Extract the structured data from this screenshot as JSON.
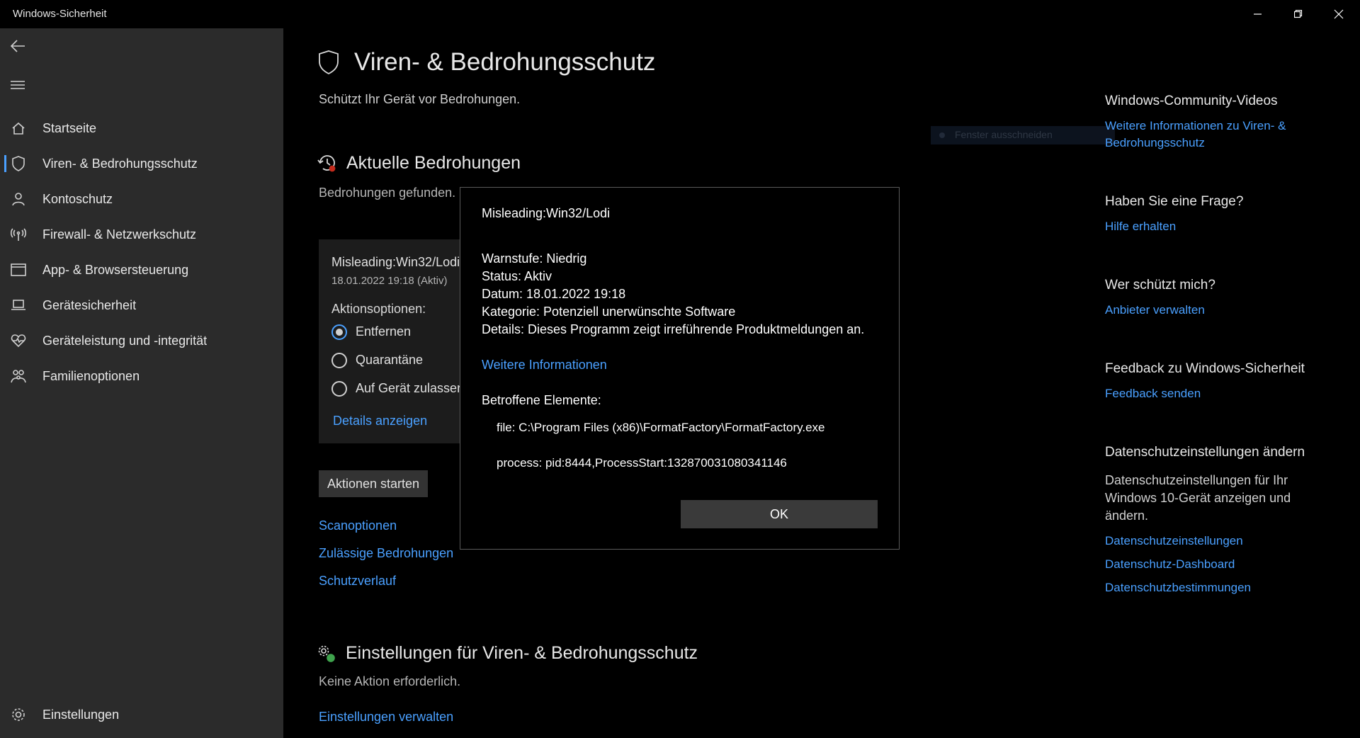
{
  "window": {
    "title": "Windows-Sicherheit"
  },
  "sidebar": {
    "items": [
      {
        "label": "Startseite",
        "icon": "home-icon"
      },
      {
        "label": "Viren- & Bedrohungsschutz",
        "icon": "shield-icon",
        "active": true
      },
      {
        "label": "Kontoschutz",
        "icon": "person-icon"
      },
      {
        "label": "Firewall- & Netzwerkschutz",
        "icon": "antenna-icon"
      },
      {
        "label": "App- & Browsersteuerung",
        "icon": "browser-window-icon"
      },
      {
        "label": "Gerätesicherheit",
        "icon": "laptop-icon"
      },
      {
        "label": "Geräteleistung und -integrität",
        "icon": "heart-pulse-icon"
      },
      {
        "label": "Familienoptionen",
        "icon": "family-icon"
      }
    ],
    "settings_label": "Einstellungen"
  },
  "main": {
    "title": "Viren- & Bedrohungsschutz",
    "subtitle": "Schützt Ihr Gerät vor Bedrohungen.",
    "current_threats": {
      "title": "Aktuelle Bedrohungen",
      "subtitle": "Bedrohungen gefunden.",
      "card": {
        "name": "Misleading:Win32/Lodi",
        "date_status": "18.01.2022 19:18 (Aktiv)",
        "actions_label": "Aktionsoptionen:",
        "options": [
          "Entfernen",
          "Quarantäne",
          "Auf Gerät zulassen"
        ],
        "selected_option": 0,
        "details_link": "Details anzeigen"
      },
      "start_actions_label": "Aktionen starten",
      "links": [
        "Scanoptionen",
        "Zulässige Bedrohungen",
        "Schutzverlauf"
      ]
    },
    "settings_section": {
      "title": "Einstellungen für Viren- & Bedrohungsschutz",
      "subtitle": "Keine Aktion erforderlich.",
      "link": "Einstellungen verwalten"
    }
  },
  "right_panel": {
    "community_title": "Windows-Community-Videos",
    "community_link": "Weitere Informationen zu Viren- & Bedrohungsschutz",
    "question_title": "Haben Sie eine Frage?",
    "question_link": "Hilfe erhalten",
    "protect_title": "Wer schützt mich?",
    "protect_link": "Anbieter verwalten",
    "feedback_title": "Feedback zu Windows-Sicherheit",
    "feedback_link": "Feedback senden",
    "privacy_title": "Datenschutzeinstellungen ändern",
    "privacy_text": "Datenschutzeinstellungen für Ihr Windows 10-Gerät anzeigen und ändern.",
    "privacy_links": [
      "Datenschutzeinstellungen",
      "Datenschutz-Dashboard",
      "Datenschutzbestimmungen"
    ]
  },
  "ghost": {
    "label": "Fenster ausschneiden"
  },
  "dialog": {
    "title": "Misleading:Win32/Lodi",
    "warn_level": "Warnstufe: Niedrig",
    "status": "Status:  Aktiv",
    "date": "Datum:  18.01.2022 19:18",
    "category": "Kategorie:  Potenziell unerwünschte Software",
    "details": "Details:  Dieses Programm zeigt irreführende Produktmeldungen an.",
    "more_info_link": "Weitere Informationen",
    "affected_label": "Betroffene Elemente:",
    "affected_items": [
      "file: C:\\Program Files (x86)\\FormatFactory\\FormatFactory.exe",
      "process: pid:8444,ProcessStart:132870031080341146"
    ],
    "ok_label": "OK"
  },
  "colors": {
    "accent": "#4aa0ff",
    "sidebar_bg": "#2b2b2b",
    "background": "#000000"
  }
}
